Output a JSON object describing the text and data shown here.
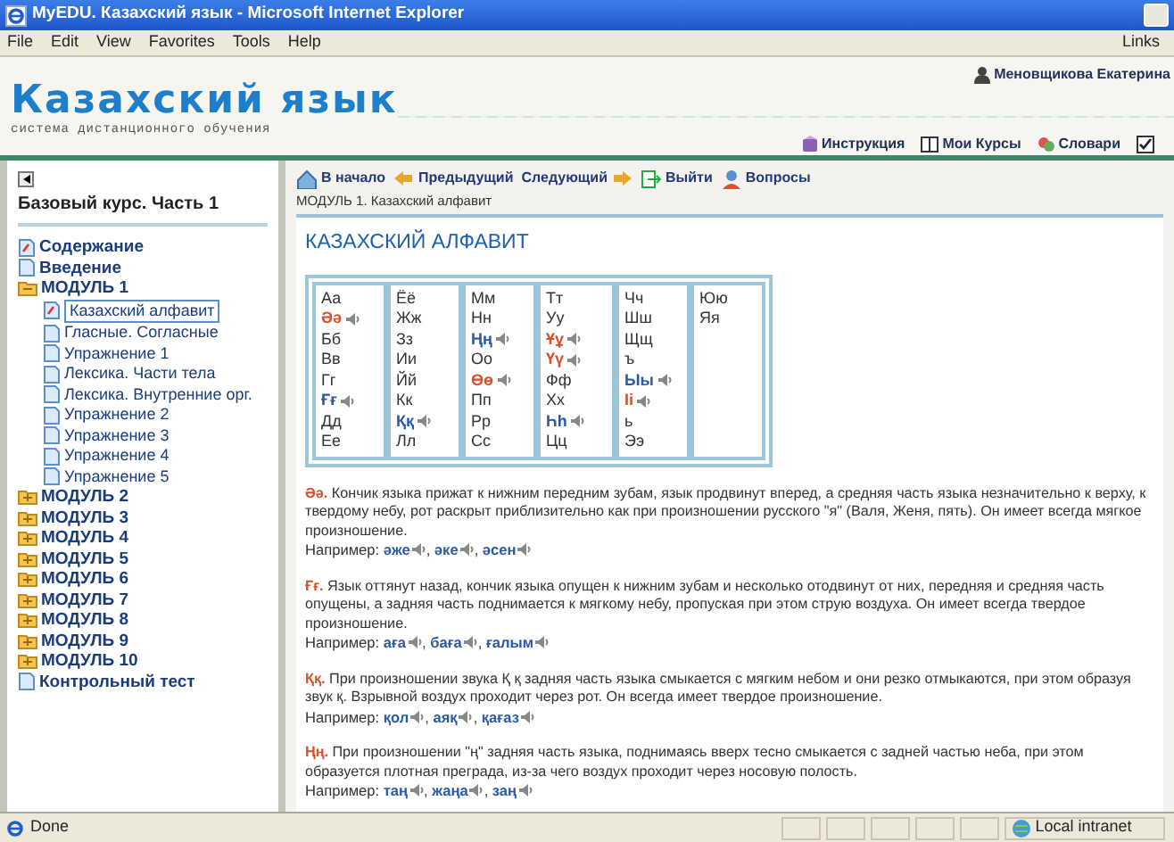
{
  "window": {
    "title": "MyEDU. Казахский язык - Microsoft Internet Explorer"
  },
  "menu": [
    "File",
    "Edit",
    "View",
    "Favorites",
    "Tools",
    "Help"
  ],
  "links_label": "Links",
  "header": {
    "logo": "Казахский язык",
    "subtitle": "система дистанционного обучения",
    "user": "Меновщикова Екатерина",
    "links": [
      {
        "label": "Инструкция",
        "kind": "book"
      },
      {
        "label": "Мои Курсы",
        "kind": "courses"
      },
      {
        "label": "Словари",
        "kind": "dictionary"
      }
    ],
    "checkbox": {
      "checked": true
    }
  },
  "sidebar": {
    "title": "Базовый курс. Часть 1",
    "tree": [
      {
        "label": "Содержание",
        "kind": "page",
        "marked": true,
        "selected": false
      },
      {
        "label": "Введение",
        "kind": "page",
        "marked": false,
        "selected": false
      },
      {
        "label": "МОДУЛЬ 1",
        "kind": "folder",
        "expanded": true,
        "children": [
          {
            "label": "Казахский алфавит",
            "kind": "page",
            "marked": true,
            "selected": true
          },
          {
            "label": "Гласные. Согласные",
            "kind": "page",
            "marked": false,
            "selected": false
          },
          {
            "label": "Упражнение 1",
            "kind": "page",
            "marked": false,
            "selected": false
          },
          {
            "label": "Лексика. Части тела",
            "kind": "page",
            "marked": false,
            "selected": false
          },
          {
            "label": "Лексика. Внутренние орг.",
            "kind": "page",
            "marked": false,
            "selected": false
          },
          {
            "label": "Упражнение 2",
            "kind": "page",
            "marked": false,
            "selected": false
          },
          {
            "label": "Упражнение 3",
            "kind": "page",
            "marked": false,
            "selected": false
          },
          {
            "label": "Упражнение 4",
            "kind": "page",
            "marked": false,
            "selected": false
          },
          {
            "label": "Упражнение 5",
            "kind": "page",
            "marked": false,
            "selected": false
          }
        ]
      },
      {
        "label": "МОДУЛЬ 2",
        "kind": "folder",
        "expanded": false
      },
      {
        "label": "МОДУЛЬ 3",
        "kind": "folder",
        "expanded": false
      },
      {
        "label": "МОДУЛЬ 4",
        "kind": "folder",
        "expanded": false
      },
      {
        "label": "МОДУЛЬ 5",
        "kind": "folder",
        "expanded": false
      },
      {
        "label": "МОДУЛЬ 6",
        "kind": "folder",
        "expanded": false
      },
      {
        "label": "МОДУЛЬ 7",
        "kind": "folder",
        "expanded": false
      },
      {
        "label": "МОДУЛЬ 8",
        "kind": "folder",
        "expanded": false
      },
      {
        "label": "МОДУЛЬ 9",
        "kind": "folder",
        "expanded": false
      },
      {
        "label": "МОДУЛЬ 10",
        "kind": "folder",
        "expanded": false
      },
      {
        "label": "Контрольный тест",
        "kind": "page",
        "marked": false,
        "selected": false
      }
    ]
  },
  "toolbar": [
    {
      "label": "В начало",
      "kind": "home"
    },
    {
      "label": "Предыдущий",
      "kind": "prev"
    },
    {
      "label": "Следующий",
      "kind": "next"
    },
    {
      "label": "Выйти",
      "kind": "exit"
    },
    {
      "label": "Вопросы",
      "kind": "questions"
    }
  ],
  "breadcrumb": "МОДУЛЬ 1. Казахский алфавит",
  "page_title": "КАЗАХСКИЙ АЛФАВИТ",
  "alphabet": {
    "columns": [
      [
        {
          "text": "Аа",
          "color": "#333333",
          "audio": false
        },
        {
          "text": "Әә",
          "color": "#d9502a",
          "audio": true
        },
        {
          "text": "Бб",
          "color": "#333333",
          "audio": false
        },
        {
          "text": "Вв",
          "color": "#333333",
          "audio": false
        },
        {
          "text": "Гг",
          "color": "#333333",
          "audio": false
        },
        {
          "text": "Ғғ",
          "color": "#2a5aa8",
          "audio": true
        },
        {
          "text": "Дд",
          "color": "#333333",
          "audio": false
        },
        {
          "text": "Ее",
          "color": "#333333",
          "audio": false
        }
      ],
      [
        {
          "text": "Ёё",
          "color": "#333333",
          "audio": false
        },
        {
          "text": "Жж",
          "color": "#333333",
          "audio": false
        },
        {
          "text": "Зз",
          "color": "#333333",
          "audio": false
        },
        {
          "text": "Ии",
          "color": "#333333",
          "audio": false
        },
        {
          "text": "Йй",
          "color": "#333333",
          "audio": false
        },
        {
          "text": "Кк",
          "color": "#333333",
          "audio": false
        },
        {
          "text": "Ққ",
          "color": "#2a5aa8",
          "audio": true
        },
        {
          "text": "Лл",
          "color": "#333333",
          "audio": false
        }
      ],
      [
        {
          "text": "Мм",
          "color": "#333333",
          "audio": false
        },
        {
          "text": "Нн",
          "color": "#333333",
          "audio": false
        },
        {
          "text": "Ңң",
          "color": "#2a5aa8",
          "audio": true
        },
        {
          "text": "Оо",
          "color": "#333333",
          "audio": false
        },
        {
          "text": "Өө",
          "color": "#d9502a",
          "audio": true
        },
        {
          "text": "Пп",
          "color": "#333333",
          "audio": false
        },
        {
          "text": "Рр",
          "color": "#333333",
          "audio": false
        },
        {
          "text": "Сс",
          "color": "#333333",
          "audio": false
        }
      ],
      [
        {
          "text": "Тт",
          "color": "#333333",
          "audio": false
        },
        {
          "text": "Уу",
          "color": "#333333",
          "audio": false
        },
        {
          "text": "Ұұ",
          "color": "#d9502a",
          "audio": true
        },
        {
          "text": "Үү",
          "color": "#d9502a",
          "audio": true
        },
        {
          "text": "Фф",
          "color": "#333333",
          "audio": false
        },
        {
          "text": "Хх",
          "color": "#333333",
          "audio": false
        },
        {
          "text": "Һһ",
          "color": "#2a5aa8",
          "audio": true
        },
        {
          "text": "Цц",
          "color": "#333333",
          "audio": false
        }
      ],
      [
        {
          "text": "Чч",
          "color": "#333333",
          "audio": false
        },
        {
          "text": "Шш",
          "color": "#333333",
          "audio": false
        },
        {
          "text": "Щщ",
          "color": "#333333",
          "audio": false
        },
        {
          "text": "ъ",
          "color": "#333333",
          "audio": false
        },
        {
          "text": "Ыы",
          "color": "#2a5aa8",
          "audio": true
        },
        {
          "text": "Іі",
          "color": "#d9502a",
          "audio": true
        },
        {
          "text": "ь",
          "color": "#333333",
          "audio": false
        },
        {
          "text": "Ээ",
          "color": "#333333",
          "audio": false
        }
      ],
      [
        {
          "text": "Юю",
          "color": "#333333",
          "audio": false
        },
        {
          "text": "Яя",
          "color": "#333333",
          "audio": false
        }
      ]
    ]
  },
  "articles": [
    {
      "text": "**Әә.** Кончик языка прижат к нижним передним зубам, язык продвинут вперед, а средняя часть языка незначительно к верху, к твердому небу, рот раскрыт приблизительно как при произношении русского \"я\" (Валя, Женя, пять). Он имеет всегда мягкое произношение.",
      "example_label": "Например:",
      "examples": [
        {
          "word": "әже",
          "sep": ","
        },
        {
          "word": "әке",
          "sep": ","
        },
        {
          "word": "әсен"
        }
      ]
    },
    {
      "text": "**Ғғ.** Язык оттянут назад, кончик языка опущен к нижним зубам и несколько отодвинут от них, передняя и средняя часть опущены, а задняя часть поднимается к мягкому небу, пропуская при этом струю воздуха. Он имеет всегда твердое произношение.",
      "example_label": "Например:",
      "examples": [
        {
          "word": "аға",
          "sep": ","
        },
        {
          "word": "баға",
          "sep": ","
        },
        {
          "word": "ғалым"
        }
      ]
    },
    {
      "text": "**Ққ.** При произношении звука Қ қ задняя часть языка смыкается с мягким небом и они резко отмыкаются, при этом образуя звук қ. Взрывной воздух проходит через рот. Он всегда имеет твердое произношение.",
      "example_label": "Например:",
      "examples": [
        {
          "word": "қол",
          "sep": ","
        },
        {
          "word": "аяқ",
          "sep": ","
        },
        {
          "word": "қағаз"
        }
      ]
    },
    {
      "text": "**Ңң.** При произношении \"ң\" задняя часть языка, поднимаясь вверх тесно смыкается с задней частью неба, при этом образуется плотная преграда, из-за чего воздух проходит через носовую полость.",
      "example_label": "Например:",
      "examples": [
        {
          "word": "таң",
          "sep": ","
        },
        {
          "word": "жаңа",
          "sep": ","
        },
        {
          "word": "заң"
        }
      ]
    }
  ],
  "status_bar": {
    "text": "Done",
    "zone": "Local intranet"
  }
}
